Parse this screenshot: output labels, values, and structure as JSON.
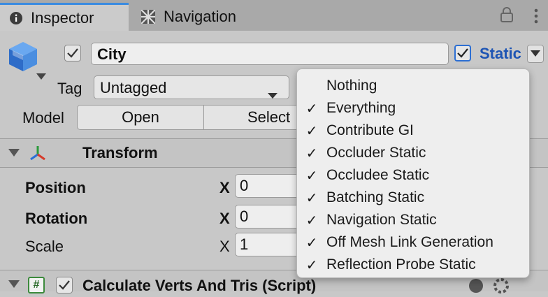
{
  "tabs": [
    {
      "label": "Inspector",
      "icon": "info-icon",
      "active": true
    },
    {
      "label": "Navigation",
      "icon": "navigation-icon",
      "active": false
    }
  ],
  "header": {
    "object_name": "City",
    "active": true,
    "static_label": "Static",
    "static_checked": true
  },
  "tag": {
    "label": "Tag",
    "value": "Untagged"
  },
  "model": {
    "label": "Model",
    "open_label": "Open",
    "select_label": "Select"
  },
  "transform": {
    "title": "Transform",
    "rows": [
      {
        "label": "Position",
        "bold": true,
        "x_label": "X",
        "x_value": "0"
      },
      {
        "label": "Rotation",
        "bold": true,
        "x_label": "X",
        "x_value": "0"
      },
      {
        "label": "Scale",
        "bold": false,
        "x_label": "X",
        "x_value": "1"
      }
    ]
  },
  "script_component": {
    "icon_text": "#",
    "title": "Calculate Verts And Tris (Script)",
    "enabled": true
  },
  "static_menu": {
    "items": [
      {
        "label": "Nothing",
        "checked": false
      },
      {
        "label": "Everything",
        "checked": true
      },
      {
        "label": "Contribute GI",
        "checked": true
      },
      {
        "label": "Occluder Static",
        "checked": true
      },
      {
        "label": "Occludee Static",
        "checked": true
      },
      {
        "label": "Batching Static",
        "checked": true
      },
      {
        "label": "Navigation Static",
        "checked": true
      },
      {
        "label": "Off Mesh Link Generation",
        "checked": true
      },
      {
        "label": "Reflection Probe Static",
        "checked": true
      }
    ]
  },
  "colors": {
    "accent": "#3a8be0",
    "static_label": "#1e55b4",
    "panel": "#c8c8c8",
    "menu_bg": "#eeeeee"
  }
}
